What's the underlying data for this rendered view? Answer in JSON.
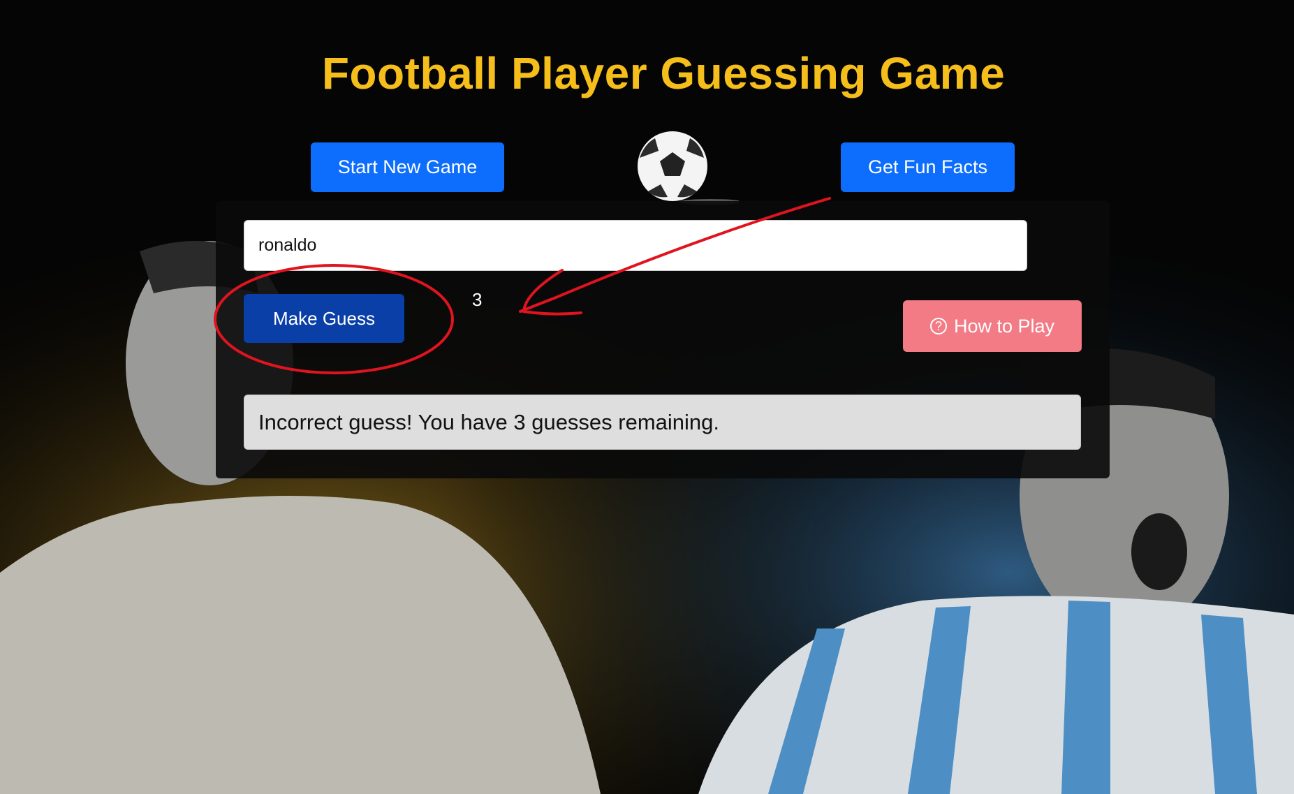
{
  "header": {
    "title": "Football Player Guessing Game"
  },
  "buttons": {
    "start_new_game": "Start New Game",
    "get_fun_facts": "Get Fun Facts",
    "make_guess": "Make Guess",
    "how_to_play": "How to Play",
    "how_to_play_icon": "question-circle-icon"
  },
  "guess": {
    "input_value": "ronaldo"
  },
  "counter": "3",
  "message": "Incorrect guess! You have 3 guesses remaining.",
  "colors": {
    "title": "#f6be1a",
    "primary_button": "#0d6efd",
    "make_guess_button": "#0a3fa8",
    "how_to_play_button": "#f27b86",
    "annotation": "#e0141e"
  }
}
